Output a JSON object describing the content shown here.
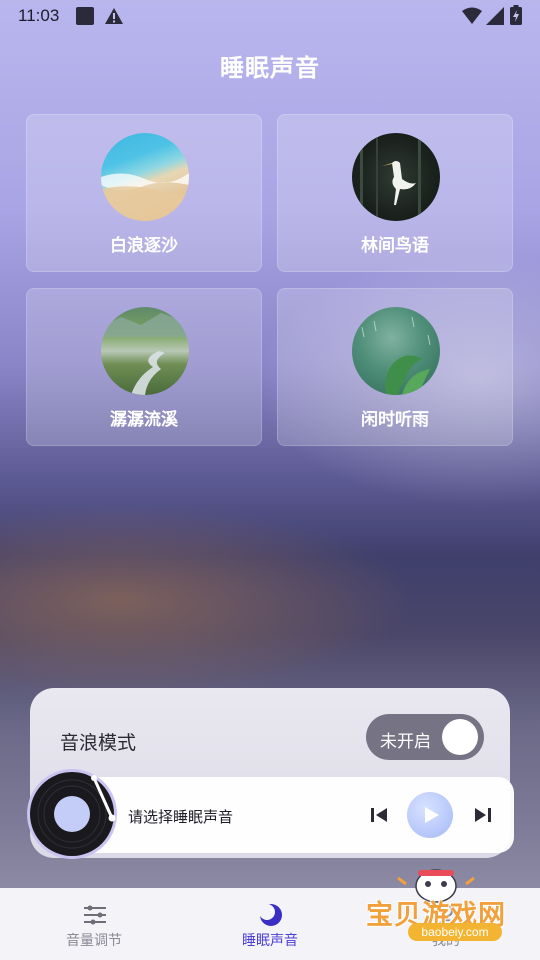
{
  "status_bar": {
    "time": "11:03"
  },
  "header": {
    "title": "睡眠声音"
  },
  "sounds": [
    {
      "label": "白浪逐沙",
      "image": "beach-waves"
    },
    {
      "label": "林间鸟语",
      "image": "egret-forest"
    },
    {
      "label": "潺潺流溪",
      "image": "mountain-stream"
    },
    {
      "label": "闲时听雨",
      "image": "rain-leaves"
    }
  ],
  "wave_mode": {
    "label": "音浪模式",
    "toggle_text": "未开启",
    "enabled": false
  },
  "player": {
    "placeholder": "请选择睡眠声音"
  },
  "nav": {
    "items": [
      {
        "label": "音量调节",
        "icon": "sliders-icon",
        "active": false
      },
      {
        "label": "睡眠声音",
        "icon": "moon-icon",
        "active": true
      },
      {
        "label": "我的",
        "icon": "user-icon",
        "active": false
      }
    ]
  },
  "watermark": {
    "title": "宝贝游戏网",
    "url": "baobeiy.com"
  },
  "colors": {
    "accent": "#4b3fd8",
    "toggle_bg": "#757384",
    "play_button": "#b9c9fb"
  }
}
